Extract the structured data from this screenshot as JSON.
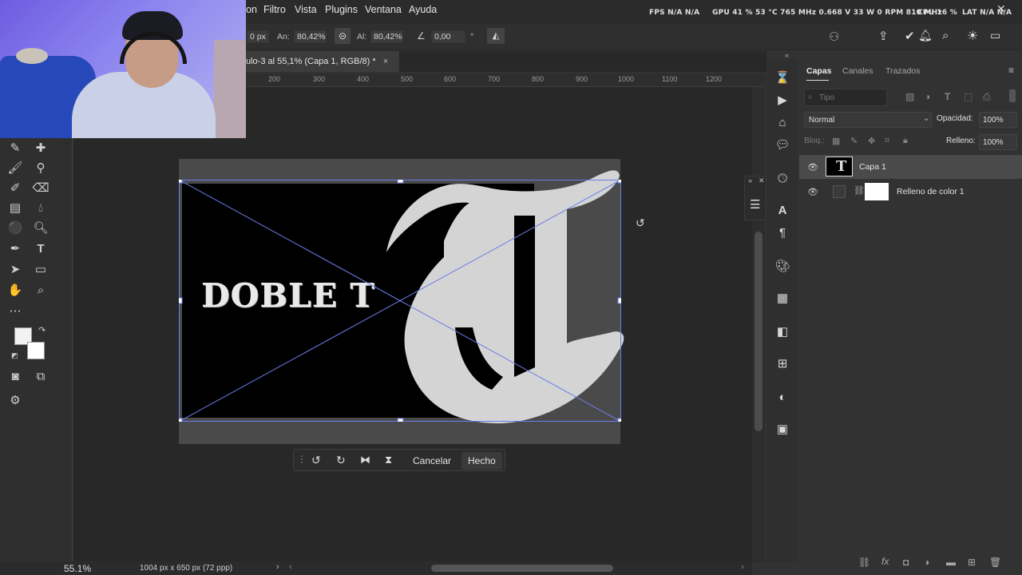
{
  "menubar": {
    "items": [
      "on",
      "Filtro",
      "Vista",
      "Plugins",
      "Ventana",
      "Ayuda"
    ],
    "stats": {
      "fps": "FPS  N/A  N/A",
      "gpu": "GPU  41 %  53 °C  765 MHz  0.668 V  33 W  0 RPM  810 MHz",
      "cpu": "CPU  16 %",
      "lat": "LAT  N/A  N/A"
    }
  },
  "options": {
    "x_value": "0 px",
    "width_label": "An:",
    "width_value": "80,42%",
    "height_label": "Al:",
    "height_value": "80,42%",
    "angle_value": "0,00",
    "angle_unit": "°"
  },
  "document": {
    "tab_title": "ulo-3 al 55,1% (Capa 1, RGB/8) *",
    "ruler_ticks": [
      "200",
      "300",
      "400",
      "500",
      "600",
      "700",
      "800",
      "900",
      "1000",
      "1100",
      "1200"
    ],
    "canvas_text": "DOBLE T"
  },
  "transform_bar": {
    "cancel_label": "Cancelar",
    "done_label": "Hecho"
  },
  "statusbar": {
    "zoom": "55.1%",
    "doc_info": "1004 px x 650 px (72 ppp)"
  },
  "layers_panel": {
    "tabs": [
      "Capas",
      "Canales",
      "Trazados"
    ],
    "search_placeholder": "Tipo",
    "blend_mode": "Normal",
    "opacity_label": "Opacidad:",
    "opacity_value": "100%",
    "lock_label": "Bloq.:",
    "fill_label": "Relleno:",
    "fill_value": "100%",
    "layers": [
      {
        "name": "Capa 1",
        "selected": true
      },
      {
        "name": "Relleno de color 1",
        "selected": false
      }
    ]
  },
  "colors": {
    "accent_transform": "#6a7de8",
    "panel_bg": "#323232"
  }
}
